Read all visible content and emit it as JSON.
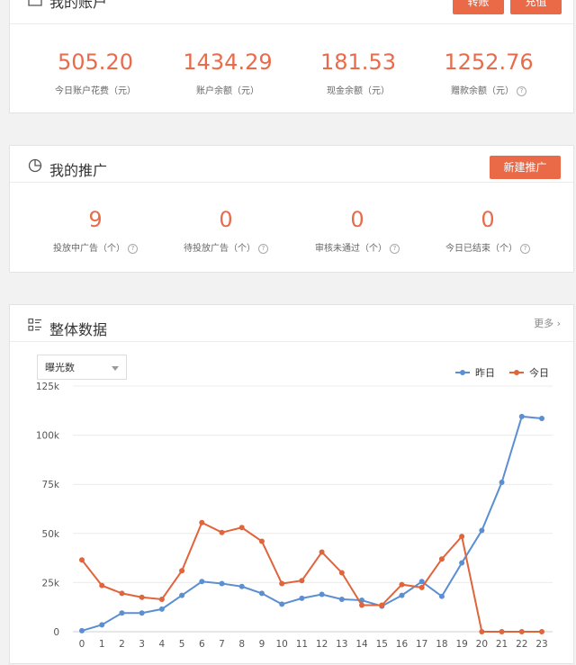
{
  "account": {
    "title": "我的账户",
    "transfer_label": "转账",
    "recharge_label": "充值",
    "stats": [
      {
        "value": "505.20",
        "label": "今日账户花费（元）",
        "help": false
      },
      {
        "value": "1434.29",
        "label": "账户余额（元）",
        "help": false
      },
      {
        "value": "181.53",
        "label": "现金余额（元）",
        "help": false
      },
      {
        "value": "1252.76",
        "label": "赠款余额（元）",
        "help": true
      }
    ]
  },
  "promotion": {
    "title": "我的推广",
    "new_label": "新建推广",
    "stats": [
      {
        "value": "9",
        "label": "投放中广告（个）",
        "help": true
      },
      {
        "value": "0",
        "label": "待投放广告（个）",
        "help": true
      },
      {
        "value": "0",
        "label": "审核未通过（个）",
        "help": true
      },
      {
        "value": "0",
        "label": "今日已结束（个）",
        "help": true
      }
    ]
  },
  "overview": {
    "title": "整体数据",
    "more_label": "更多",
    "metric_select": "曝光数"
  },
  "colors": {
    "accent": "#ea6a47",
    "yesterday": "#5b8fd1",
    "today": "#e0643c"
  },
  "chart_data": {
    "type": "line",
    "x": [
      0,
      1,
      2,
      3,
      4,
      5,
      6,
      7,
      8,
      9,
      10,
      11,
      12,
      13,
      14,
      15,
      16,
      17,
      18,
      19,
      20,
      21,
      22,
      23
    ],
    "y_ticks": [
      "0",
      "25k",
      "50k",
      "75k",
      "100k",
      "125k"
    ],
    "ylim": [
      0,
      125000
    ],
    "legend_position": "top-right",
    "grid": true,
    "series": [
      {
        "name": "昨日",
        "values": [
          500,
          3500,
          9500,
          9500,
          11500,
          18500,
          25500,
          24500,
          23000,
          19500,
          14000,
          17000,
          19000,
          16500,
          16000,
          13000,
          18500,
          25500,
          18000,
          35000,
          51500,
          76000,
          109500,
          108500
        ]
      },
      {
        "name": "今日",
        "values": [
          36500,
          23500,
          19500,
          17500,
          16500,
          31000,
          55500,
          50500,
          53000,
          46000,
          24500,
          26000,
          40500,
          30000,
          13500,
          13500,
          24000,
          22500,
          37000,
          48500,
          0,
          0,
          0,
          0
        ]
      }
    ]
  }
}
